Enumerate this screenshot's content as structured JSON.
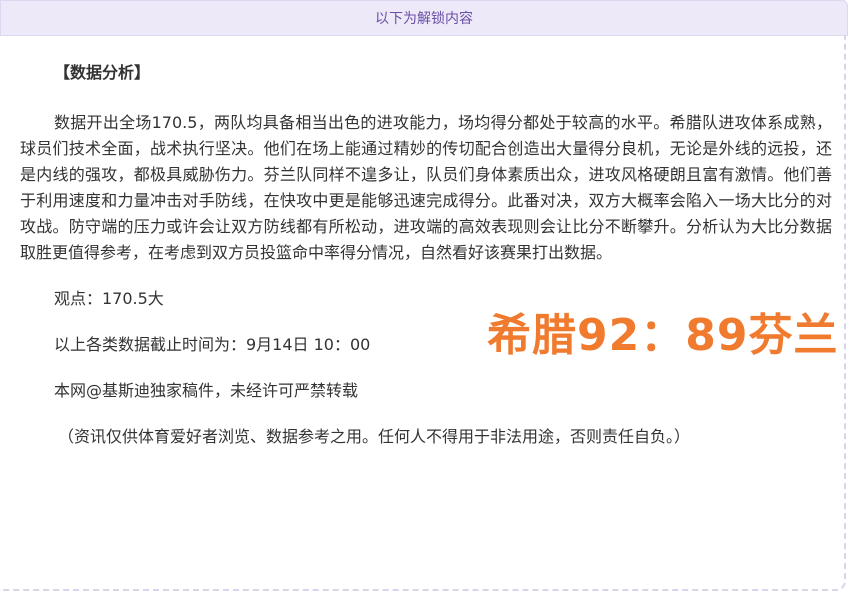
{
  "banner": {
    "text": "以下为解锁内容"
  },
  "article": {
    "section_title": "【数据分析】",
    "paragraph": "数据开出全场170.5，两队均具备相当出色的进攻能力，场均得分都处于较高的水平。希腊队进攻体系成熟，球员们技术全面，战术执行坚决。他们在场上能通过精妙的传切配合创造出大量得分良机，无论是外线的远投，还是内线的强攻，都极具威胁伤力。芬兰队同样不遑多让，队员们身体素质出众，进攻风格硬朗且富有激情。他们善于利用速度和力量冲击对手防线，在快攻中更是能够迅速完成得分。此番对决，双方大概率会陷入一场大比分的对攻战。防守端的压力或许会让双方防线都有所松动，进攻端的高效表现则会让比分不断攀升。分析认为大比分数据取胜更值得参考，在考虑到双方员投篮命中率得分情况，自然看好该赛果打出数据。",
    "viewpoint": "观点：170.5大",
    "cutoff": "以上各类数据截止时间为：9月14日 10：00",
    "copyright": "本网@基斯迪独家稿件，未经许可严禁转载",
    "disclaimer": "（资讯仅供体育爱好者浏览、数据参考之用。任何人不得用于非法用途，否则责任自负。）"
  },
  "overlay": {
    "score_text": "希腊92：89芬兰",
    "color": "#f07a2e"
  }
}
